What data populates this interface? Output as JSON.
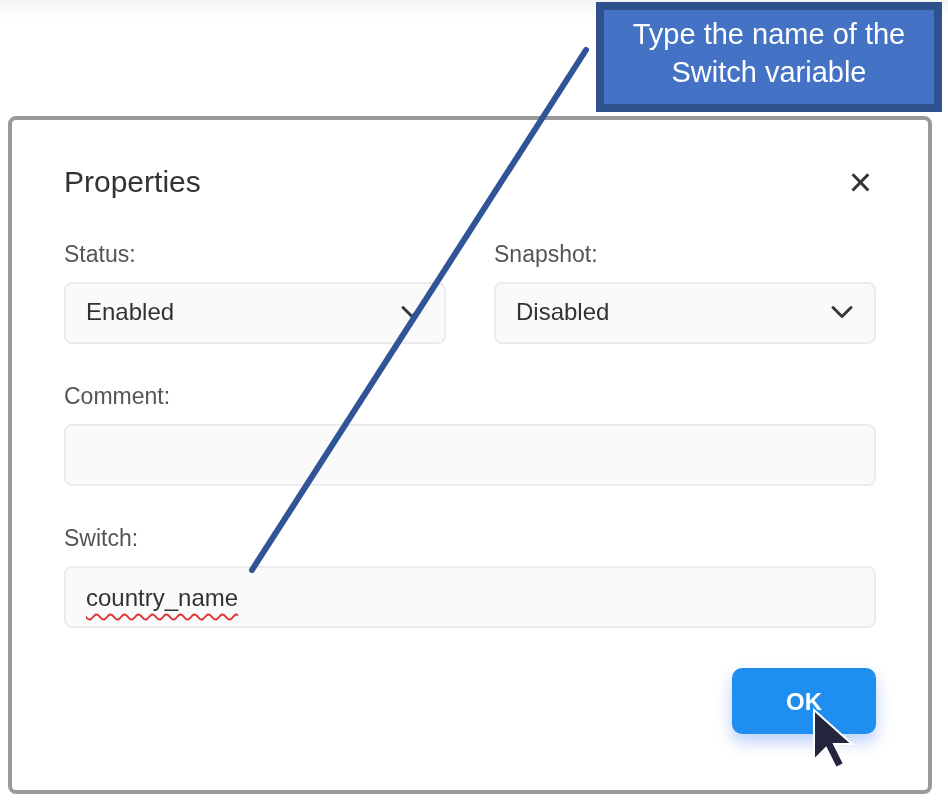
{
  "callout": {
    "text": "Type the name of the Switch variable"
  },
  "dialog": {
    "title": "Properties",
    "close": "×",
    "fields": [
      {
        "kind": "select",
        "label": "Status:",
        "value": "Enabled"
      },
      {
        "kind": "select",
        "label": "Snapshot:",
        "value": "Disabled"
      },
      {
        "kind": "text",
        "label": "Comment:"
      },
      {
        "kind": "text",
        "label": "Switch:",
        "value": "country_name",
        "misspelled": true
      }
    ],
    "button": "OK"
  }
}
